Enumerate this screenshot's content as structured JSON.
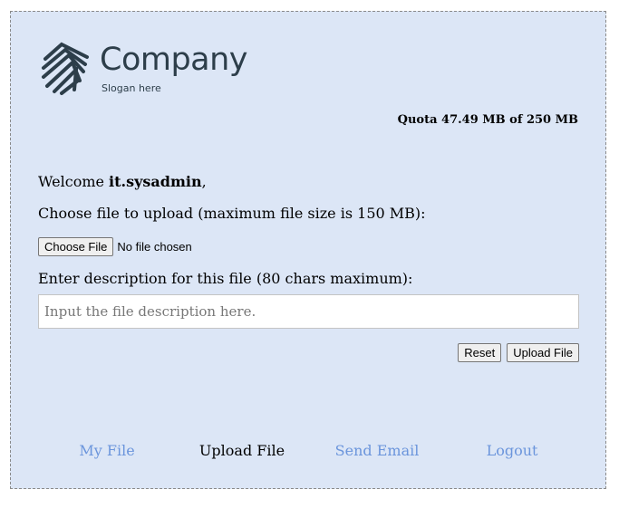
{
  "logo": {
    "name": "Company",
    "slogan": "Slogan here",
    "icon": "shield-stripes-icon",
    "color": "#2d3e4a"
  },
  "quota": {
    "text": "Quota 47.49 MB of 250 MB"
  },
  "welcome": {
    "prefix": "Welcome ",
    "username": "it.sysadmin",
    "suffix": ","
  },
  "upload": {
    "choose_label": "Choose file to upload (maximum file size is 150 MB):",
    "choose_button": "Choose File",
    "file_status": "No file chosen",
    "desc_label": "Enter description for this file (80 chars maximum):",
    "desc_placeholder": "Input the file description here.",
    "reset_button": "Reset",
    "upload_button": "Upload File"
  },
  "nav": {
    "items": [
      {
        "label": "My File",
        "current": false
      },
      {
        "label": "Upload File",
        "current": true
      },
      {
        "label": "Send Email",
        "current": false
      },
      {
        "label": "Logout",
        "current": false
      }
    ]
  },
  "colors": {
    "panel_bg": "#dce6f6",
    "link": "#6b95dc",
    "text": "#000000"
  }
}
